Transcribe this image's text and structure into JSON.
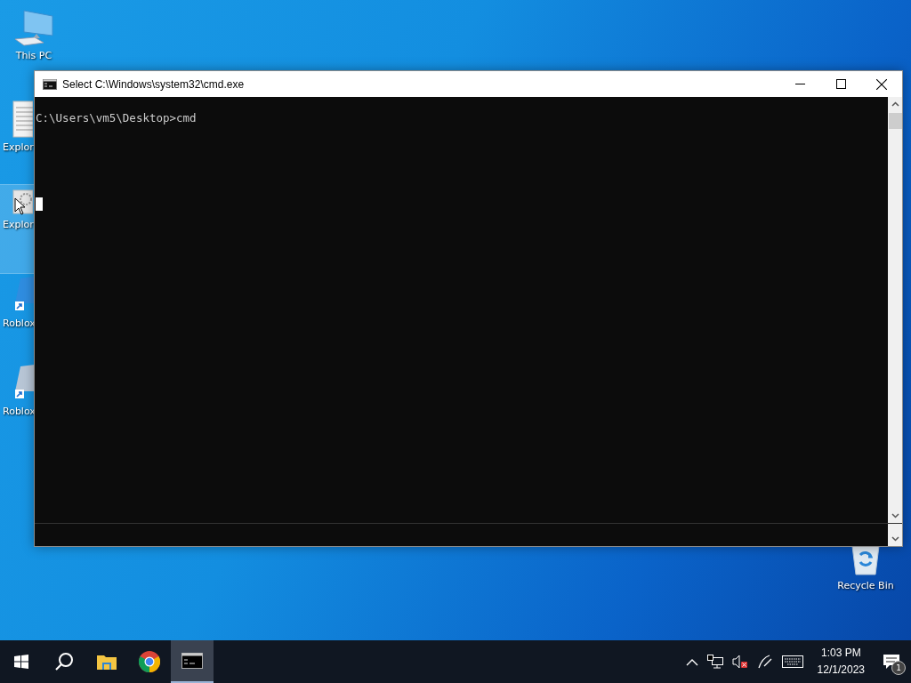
{
  "desktop": {
    "icons": [
      {
        "label": "This PC",
        "kind": "pc",
        "selected": false
      },
      {
        "label": "Explor",
        "kind": "document",
        "selected": false
      },
      {
        "label": "Explor",
        "kind": "settings",
        "selected": true
      },
      {
        "label": "Roblox",
        "kind": "roblox",
        "selected": false
      },
      {
        "label": "Roblox",
        "kind": "roblox-studio",
        "selected": false
      },
      {
        "label": "Recycle Bin",
        "kind": "recycle",
        "selected": false
      }
    ]
  },
  "window": {
    "title": "Select C:\\Windows\\system32\\cmd.exe",
    "lines": [
      "C:\\Users\\vm5\\Desktop>cmd"
    ]
  },
  "taskbar": {
    "apps": [
      {
        "kind": "start",
        "active": false
      },
      {
        "kind": "search",
        "active": false
      },
      {
        "kind": "folder",
        "active": false
      },
      {
        "kind": "chrome",
        "active": false
      },
      {
        "kind": "terminal",
        "active": true
      }
    ],
    "tray": {
      "time": "1:03 PM",
      "date": "12/1/2023",
      "notifications": "1"
    }
  }
}
